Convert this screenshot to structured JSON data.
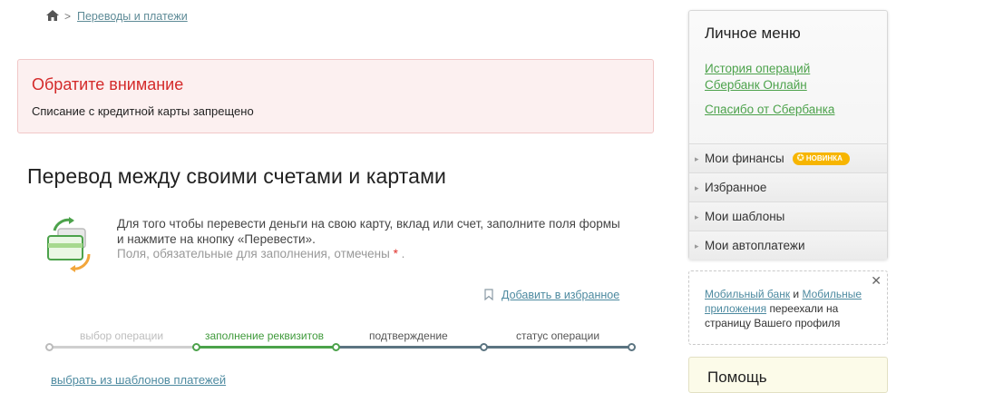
{
  "breadcrumb": {
    "home_icon": "home-icon",
    "separator": ">",
    "link": "Переводы и платежи"
  },
  "alert": {
    "title": "Обратите внимание",
    "text": "Списание с кредитной карты запрещено"
  },
  "page": {
    "title": "Перевод между своими счетами и картами",
    "info_text": "Для того чтобы перевести деньги на свою карту, вклад или счет, заполните поля формы и нажмите на кнопку «Перевести».",
    "required_text": "Поля, обязательные для заполнения, отмечены",
    "required_mark": "*",
    "required_end": ".",
    "favorite_link": "Добавить в избранное",
    "bottom_link": "выбрать из шаблонов платежей"
  },
  "steps": [
    {
      "label": "выбор операции",
      "state": "done"
    },
    {
      "label": "заполнение реквизитов",
      "state": "active"
    },
    {
      "label": "подтверждение",
      "state": "pending"
    },
    {
      "label": "статус операции",
      "state": "pending"
    }
  ],
  "sidebar": {
    "title": "Личное меню",
    "links": [
      "История операций Сбербанк Онлайн",
      "Спасибо от Сбербанка"
    ],
    "items": [
      {
        "label": "Мои финансы",
        "badge": "НОВИНКА"
      },
      {
        "label": "Избранное"
      },
      {
        "label": "Мои шаблоны"
      },
      {
        "label": "Мои автоплатежи"
      }
    ],
    "notice": {
      "close": "✕",
      "link1": "Мобильный банк",
      "and": "и",
      "link2": "Мобильные приложения",
      "rest": "переехали на страницу Вашего профиля"
    },
    "help_title": "Помощь"
  },
  "colors": {
    "brand_green": "#4ca24b",
    "alert_red": "#d42a2a",
    "link_blue": "#4d8aa0",
    "badge_orange": "#f7b500"
  }
}
